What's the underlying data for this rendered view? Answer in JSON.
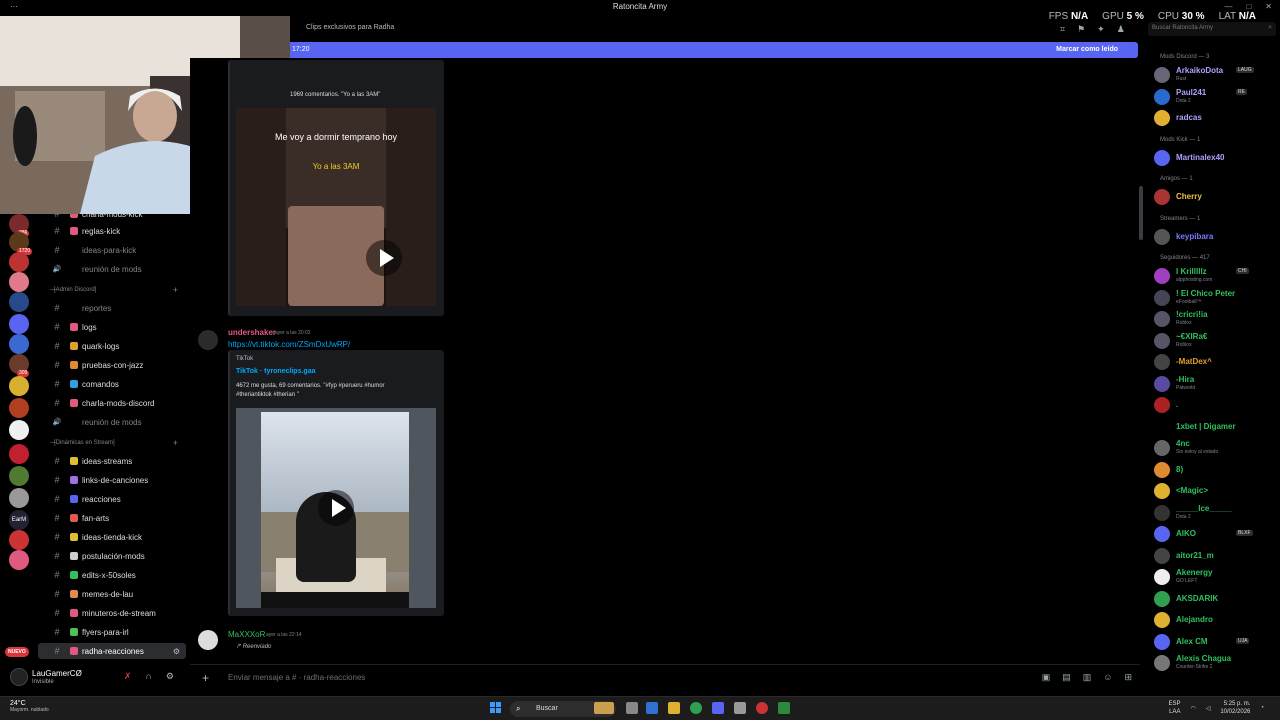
{
  "window": {
    "title": "Ratoncita Army",
    "controls": [
      "—",
      "□",
      "✕"
    ]
  },
  "header": {
    "topic": "Clips exclusivos para Radha",
    "search_placeholder": "Buscar Ratoncita Army",
    "hud": [
      {
        "label": "FPS",
        "value": "N/A"
      },
      {
        "label": "GPU",
        "value": "5 %"
      },
      {
        "label": "CPU",
        "value": "30 %"
      },
      {
        "label": "LAT",
        "value": "N/A"
      }
    ]
  },
  "banner": {
    "time": "17:20",
    "mark_read": "Marcar como leído"
  },
  "rail": {
    "nuevo_label": "NUEVO",
    "servers": [
      {
        "label": "",
        "badge": "286",
        "color": "#7a2a2a"
      },
      {
        "label": "",
        "badge": "1720",
        "color": "#5a3a1a"
      },
      {
        "label": "",
        "badge": "",
        "color": "#b33"
      },
      {
        "label": "",
        "badge": "",
        "color": "#e07a8a"
      },
      {
        "label": "",
        "badge": "",
        "color": "#274a8a"
      },
      {
        "label": "",
        "badge": "",
        "color": "#5865f2"
      },
      {
        "label": "",
        "badge": "",
        "color": "#3a6ad0"
      },
      {
        "label": "",
        "badge": "309",
        "color": "#6a3a2a"
      },
      {
        "label": "",
        "badge": "",
        "color": "#d8b030"
      },
      {
        "label": "",
        "badge": "",
        "color": "#b04020"
      },
      {
        "label": "",
        "badge": "",
        "color": "#f0f0f0"
      },
      {
        "label": "",
        "badge": "",
        "color": "#c02030"
      },
      {
        "label": "",
        "badge": "",
        "color": "#507a30"
      },
      {
        "label": "",
        "badge": "",
        "color": "#999"
      },
      {
        "label": "EarM",
        "badge": "",
        "color": "#223"
      },
      {
        "label": "",
        "badge": "",
        "color": "#c33"
      },
      {
        "label": "",
        "badge": "",
        "color": "#e05a80"
      }
    ]
  },
  "sidebar": {
    "categories": {
      "admin": "[Admin Discord]",
      "dinamicas": "[Dinámicas en Stream]"
    },
    "channels": [
      {
        "name": "charla-mods-kick",
        "type": "text",
        "color": "#e05a80",
        "state": "normal"
      },
      {
        "name": "reglas-kick",
        "type": "text",
        "color": "#e05a80",
        "state": "normal"
      },
      {
        "name": "ideas-para-kick",
        "type": "text",
        "color": "",
        "state": "muted"
      },
      {
        "name": "reunión de mods",
        "type": "voice",
        "color": "",
        "state": "muted"
      },
      {
        "name": "reportes",
        "type": "text",
        "color": "",
        "state": "muted"
      },
      {
        "name": "logs",
        "type": "text",
        "color": "#e05a80",
        "state": "normal"
      },
      {
        "name": "quark-logs",
        "type": "text",
        "color": "#e0a030",
        "state": "normal"
      },
      {
        "name": "pruebas-con-jazz",
        "type": "text",
        "color": "#e08a30",
        "state": "normal"
      },
      {
        "name": "comandos",
        "type": "text",
        "color": "#30a0e0",
        "state": "normal"
      },
      {
        "name": "charla-mods-discord",
        "type": "text",
        "color": "#e05a80",
        "state": "normal"
      },
      {
        "name": "reunión de mods",
        "type": "voice",
        "color": "",
        "state": "muted"
      },
      {
        "name": "ideas-streams",
        "type": "text",
        "color": "#e0c030",
        "state": "normal"
      },
      {
        "name": "links-de-canciones",
        "type": "text",
        "color": "#a070e0",
        "state": "normal"
      },
      {
        "name": "reacciones",
        "type": "text",
        "color": "#5865f2",
        "state": "normal"
      },
      {
        "name": "fan-arts",
        "type": "text",
        "color": "#e05a50",
        "state": "normal"
      },
      {
        "name": "ideas-tienda-kick",
        "type": "text",
        "color": "#e0c030",
        "state": "normal"
      },
      {
        "name": "postulación-mods",
        "type": "text",
        "color": "#ccc",
        "state": "normal"
      },
      {
        "name": "edits-x-50soles",
        "type": "text",
        "color": "#30c060",
        "state": "normal"
      },
      {
        "name": "memes-de-lau",
        "type": "text",
        "color": "#e08a50",
        "state": "normal"
      },
      {
        "name": "minuteros-de-stream",
        "type": "text",
        "color": "#e05a80",
        "state": "normal"
      },
      {
        "name": "flyers-para-irl",
        "type": "text",
        "color": "#50c050",
        "state": "normal"
      },
      {
        "name": "radha-reacciones",
        "type": "text",
        "color": "#e05a80",
        "state": "active"
      }
    ]
  },
  "user": {
    "name": "LauGamerCØ",
    "status": "Invisible"
  },
  "chat": {
    "embed1": {
      "stats": "1969 comentarios. \"Yo a las 3AM\"",
      "video_caption_1": "Me voy a dormir temprano hoy",
      "video_caption_2": "Yo a las 3AM"
    },
    "msg1": {
      "author": "undershaker",
      "time": "ayer a las 20:02",
      "link": "https://vt.tiktok.com/ZSmDxUwRP/",
      "embed_provider": "TikTok",
      "embed_title": "TikTok · tyroneclips.gaa",
      "embed_desc": "4672 me gusta, 69 comentarios. \"#fyp #perueru #humor #theriantiktok #therian \""
    },
    "msg2": {
      "author": "MaXXXoR",
      "time": "ayer a las 22:14",
      "forward": "Reenviado"
    },
    "input_placeholder": "Enviar mensaje a #  · radha-reacciones"
  },
  "members": {
    "groups": [
      {
        "title": "Mods Discord — 3",
        "items": [
          {
            "name": "ArkaikoDota",
            "sub": "Rust",
            "tag": "LAUG",
            "color": "#b0a0ff",
            "av": "#667"
          },
          {
            "name": "Paul241",
            "sub": "Dota 2",
            "tag": "RE",
            "color": "#b0a0ff",
            "av": "#2a6ad0"
          },
          {
            "name": "radcas",
            "sub": "",
            "tag": "",
            "color": "#b0a0ff",
            "av": "#e0b030"
          }
        ]
      },
      {
        "title": "Mods Kick — 1",
        "items": [
          {
            "name": "Martinalex40",
            "sub": "",
            "tag": "",
            "color": "#b0a0ff",
            "av": "#5865f2"
          }
        ]
      },
      {
        "title": "Amigos — 1",
        "items": [
          {
            "name": "Cherry",
            "sub": "",
            "tag": "",
            "color": "#f0c040",
            "av": "#a33"
          }
        ]
      },
      {
        "title": "Streamers — 1",
        "items": [
          {
            "name": "keypibara",
            "sub": "",
            "tag": "",
            "color": "#7a7aff",
            "av": "#555"
          }
        ]
      },
      {
        "title": "Seguidores — 417",
        "items": [
          {
            "name": "I Krilllllz",
            "sub": "alpphosting.com",
            "tag": "CHI",
            "color": "#30c060",
            "av": "#a040c0"
          },
          {
            "name": "! El Chico Peter",
            "sub": "eFootball™",
            "tag": "",
            "color": "#30c060",
            "av": "#445"
          },
          {
            "name": "!cricri!ia",
            "sub": "Roblox",
            "tag": "",
            "color": "#30c060",
            "av": "#556"
          },
          {
            "name": "~€XIRa€",
            "sub": "Roblox",
            "tag": "",
            "color": "#30c060",
            "av": "#556"
          },
          {
            "name": "-MatDex^",
            "sub": "",
            "tag": "",
            "color": "#e0a030",
            "av": "#444"
          },
          {
            "name": "-Hira",
            "sub": "Palworld",
            "tag": "",
            "color": "#30c060",
            "av": "#5a4aa0"
          },
          {
            "name": ".",
            "sub": "",
            "tag": "",
            "color": "#30c060",
            "av": "#a22"
          },
          {
            "name": "1xbet | Digamer",
            "sub": "",
            "tag": "",
            "color": "#30c060",
            "av": "#000"
          },
          {
            "name": "4nc",
            "sub": "Sin estoy al estado",
            "tag": "",
            "color": "#30c060",
            "av": "#666"
          },
          {
            "name": "8)",
            "sub": "",
            "tag": "",
            "color": "#30c060",
            "av": "#e08a30"
          },
          {
            "name": "<Magic>",
            "sub": "",
            "tag": "",
            "color": "#30c060",
            "av": "#e0b030"
          },
          {
            "name": "_____Ice_____",
            "sub": "Dota 2",
            "tag": "",
            "color": "#30c060",
            "av": "#333"
          },
          {
            "name": "AIKO",
            "sub": "",
            "tag": "BLXF",
            "color": "#30c060",
            "av": "#5865f2"
          },
          {
            "name": "aitor21_m",
            "sub": "",
            "tag": "",
            "color": "#30c060",
            "av": "#444"
          },
          {
            "name": "Akenergy",
            "sub": "GO LEFT",
            "tag": "",
            "color": "#30c060",
            "av": "#eee"
          },
          {
            "name": "AKSDARIK",
            "sub": "",
            "tag": "",
            "color": "#30c060",
            "av": "#30a050"
          },
          {
            "name": "Alejandro",
            "sub": "",
            "tag": "",
            "color": "#30c060",
            "av": "#e0b030"
          },
          {
            "name": "Alex CM",
            "sub": "",
            "tag": "UJA",
            "color": "#30c060",
            "av": "#5865f2"
          },
          {
            "name": "Alexis Chagua",
            "sub": "Counter-Strike 2",
            "tag": "",
            "color": "#30c060",
            "av": "#777"
          }
        ]
      }
    ]
  },
  "taskbar": {
    "weather_temp": "24°C",
    "weather_desc": "Mayorm. nublado",
    "search_label": "Buscar",
    "lang": "ESP",
    "lang2": "LAA",
    "time": "5:25 p. m.",
    "date": "10/02/2026"
  }
}
